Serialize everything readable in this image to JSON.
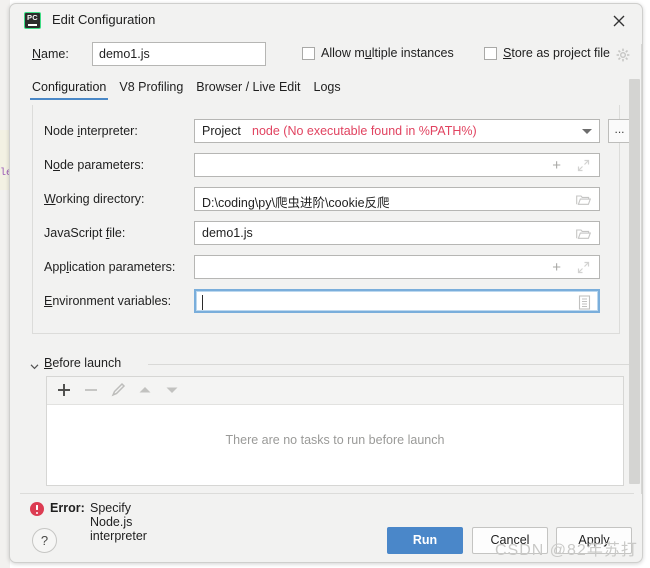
{
  "window": {
    "title": "Edit Configuration",
    "app_icon": "pycharm-icon",
    "close_icon": "close-icon"
  },
  "name_row": {
    "label": "Name:",
    "value": "demo1.js",
    "placeholder": "",
    "allow_multiple_instances": "Allow multiple instances",
    "store_as_project_file": "Store as project file",
    "gear_icon": "gear-icon"
  },
  "tabs": [
    {
      "label": "Configuration",
      "active": true
    },
    {
      "label": "V8 Profiling",
      "active": false
    },
    {
      "label": "Browser / Live Edit",
      "active": false
    },
    {
      "label": "Logs",
      "active": false
    }
  ],
  "fields": {
    "node_interpreter": {
      "label": "Node interpreter:",
      "prefix": "Project",
      "value": "node (No executable found in %PATH%)",
      "error_color": "#e14360",
      "browse_label": "..."
    },
    "node_parameters": {
      "label": "Node parameters:",
      "value": ""
    },
    "working_directory": {
      "label": "Working directory:",
      "value": "D:\\coding\\py\\爬虫进阶\\cookie反爬"
    },
    "javascript_file": {
      "label": "JavaScript file:",
      "value": "demo1.js"
    },
    "application_parameters": {
      "label": "Application parameters:",
      "value": ""
    },
    "environment_variables": {
      "label": "Environment variables:",
      "value": ""
    }
  },
  "before_launch": {
    "title": "Before launch",
    "empty_message": "There are no tasks to run before launch",
    "toolbar": [
      "add-icon",
      "remove-icon",
      "edit-pencil-icon",
      "move-up-icon",
      "move-down-icon"
    ]
  },
  "footer": {
    "error_prefix": "Error:",
    "error_message": "Specify Node.js interpreter",
    "help_label": "?",
    "run_label": "Run",
    "cancel_label": "Cancel",
    "apply_label": "Apply",
    "primary_color": "#4a87c9"
  },
  "watermark": "CSDN @82年苏打"
}
